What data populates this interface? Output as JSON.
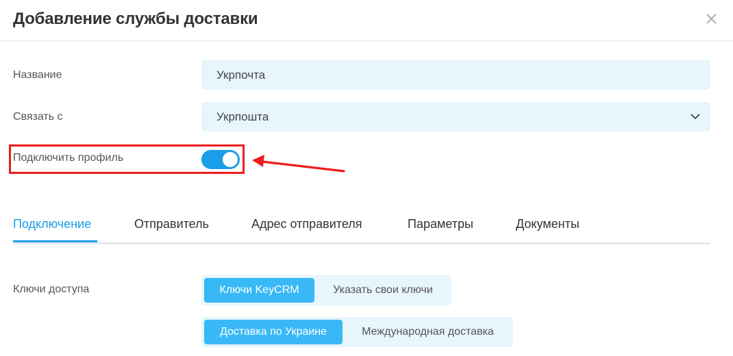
{
  "dialog": {
    "title": "Добавление службы доставки",
    "close_icon": "close-icon"
  },
  "form": {
    "name_label": "Название",
    "name_value": "Укрпочта",
    "link_label": "Связать с",
    "link_value": "Укрпошта",
    "profile_label": "Подключить профиль",
    "profile_enabled": true
  },
  "tabs": [
    {
      "label": "Подключение",
      "active": true
    },
    {
      "label": "Отправитель",
      "active": false
    },
    {
      "label": "Адрес отправителя",
      "active": false
    },
    {
      "label": "Параметры",
      "active": false
    },
    {
      "label": "Документы",
      "active": false
    }
  ],
  "connection": {
    "keys_label": "Ключи доступа",
    "keys_options": [
      "Ключи KeyCRM",
      "Указать свои ключи"
    ],
    "keys_selected": "Ключи KeyCRM",
    "delivery_options": [
      "Доставка по Украине",
      "Международная доставка"
    ],
    "delivery_selected": "Доставка по Украине"
  },
  "colors": {
    "accent": "#1a9ee8",
    "field_bg": "#e7f5fd",
    "highlight": "#ee1c1c"
  }
}
